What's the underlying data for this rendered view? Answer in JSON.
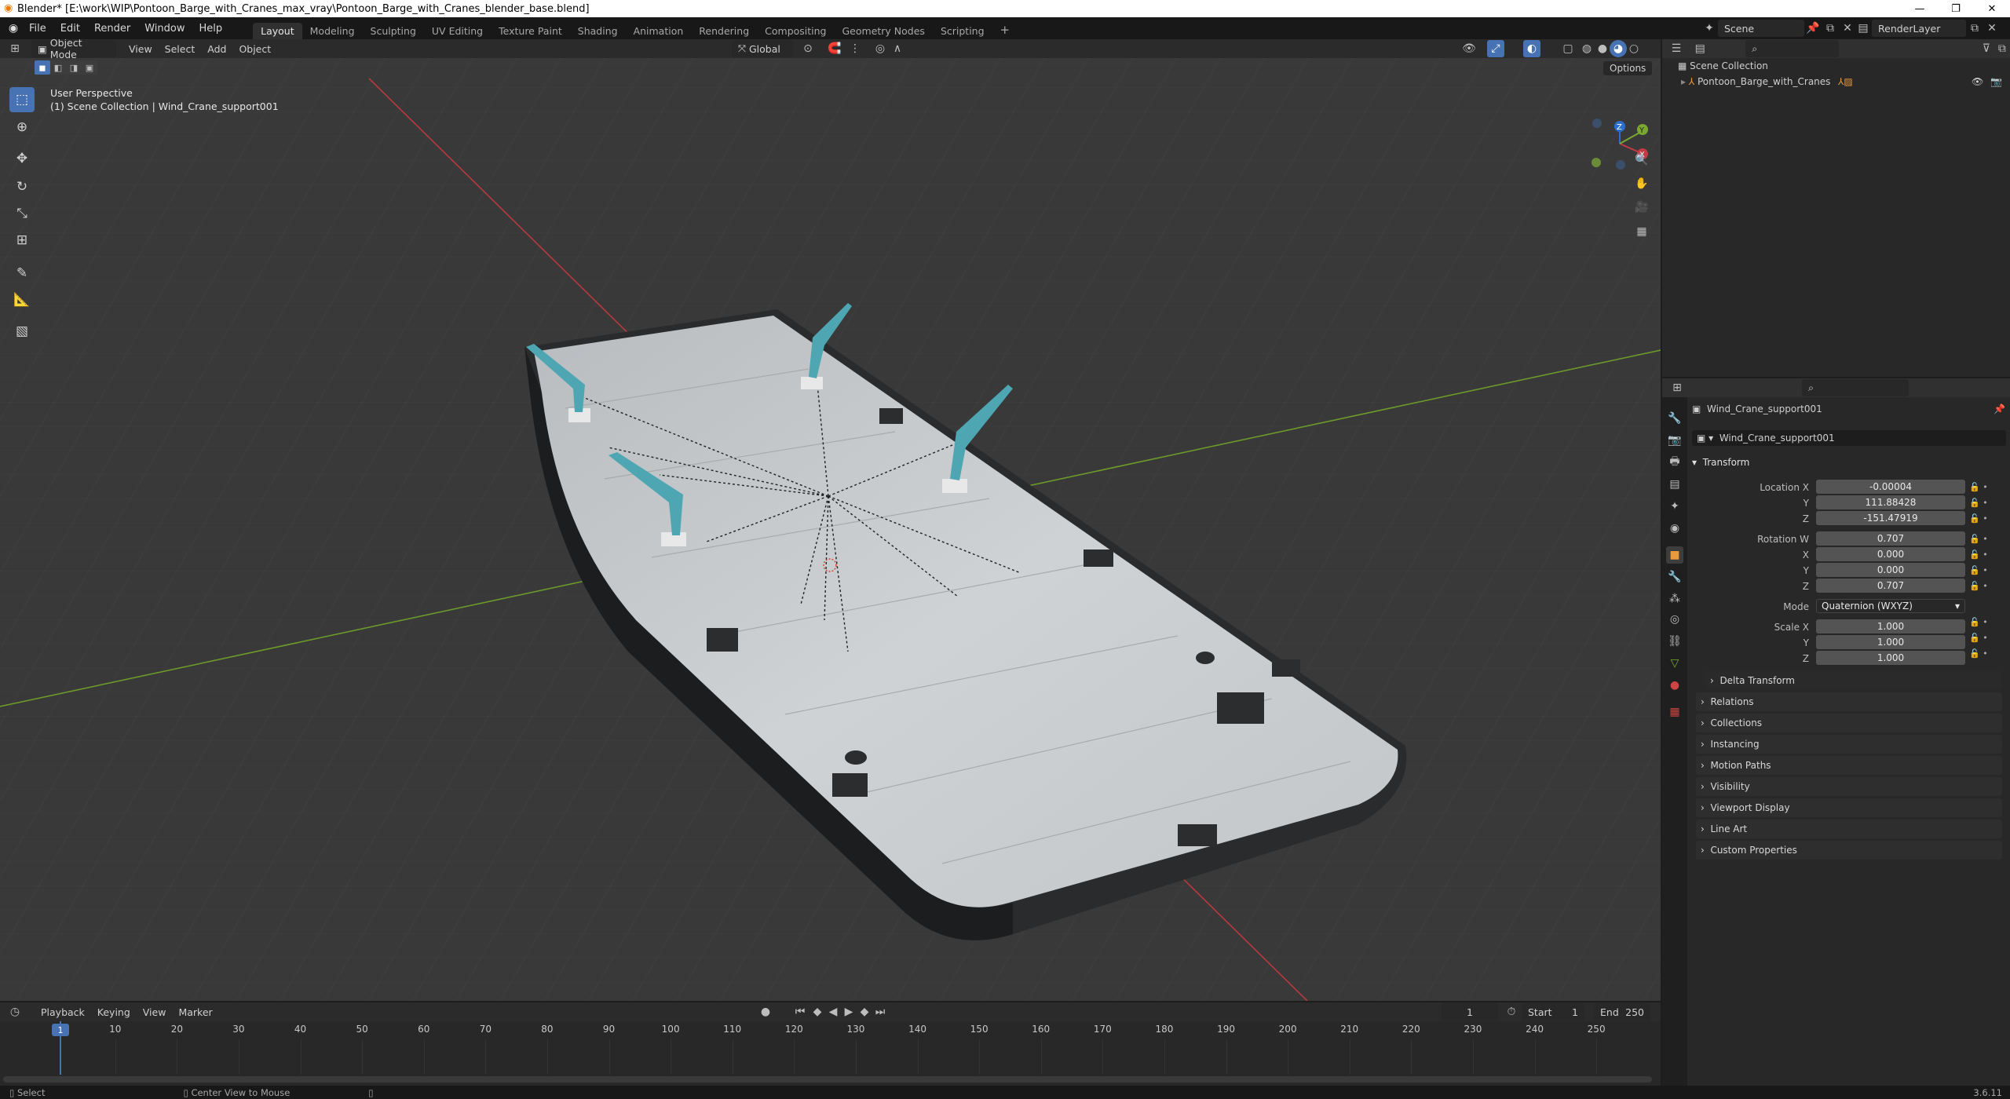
{
  "window": {
    "title": "Blender* [E:\\work\\WIP\\Pontoon_Barge_with_Cranes_max_vray\\Pontoon_Barge_with_Cranes_blender_base.blend]",
    "minimize": "—",
    "maximize": "❐",
    "close": "✕"
  },
  "menubar": {
    "items": [
      "File",
      "Edit",
      "Render",
      "Window",
      "Help"
    ],
    "workspaces": [
      "Layout",
      "Modeling",
      "Sculpting",
      "UV Editing",
      "Texture Paint",
      "Shading",
      "Animation",
      "Rendering",
      "Compositing",
      "Geometry Nodes",
      "Scripting"
    ],
    "add_tab": "+",
    "scene_label": "Scene",
    "render_layer": "RenderLayer"
  },
  "viewport": {
    "mode": "Object Mode",
    "menus": [
      "View",
      "Select",
      "Add",
      "Object"
    ],
    "transform_orientation": "Global",
    "options_label": "Options",
    "overlay_line1": "User Perspective",
    "overlay_line2": "(1) Scene Collection | Wind_Crane_support001",
    "gizmo": {
      "x": "X",
      "y": "Y",
      "z": "Z"
    }
  },
  "outliner": {
    "scene_collection": "Scene Collection",
    "items": [
      {
        "label": "Pontoon_Barge_with_Cranes"
      }
    ]
  },
  "properties": {
    "object_name": "Wind_Crane_support001",
    "data_name": "Wind_Crane_support001",
    "transform_title": "Transform",
    "location": {
      "label": "Location X",
      "x": "-0.00004",
      "y_label": "Y",
      "y": "111.88428",
      "z_label": "Z",
      "z": "-151.47919"
    },
    "rotation": {
      "label": "Rotation W",
      "w": "0.707",
      "x_label": "X",
      "x": "0.000",
      "y_label": "Y",
      "y": "0.000",
      "z_label": "Z",
      "z": "0.707"
    },
    "mode_label": "Mode",
    "mode_value": "Quaternion (WXYZ)",
    "scale": {
      "label": "Scale X",
      "x": "1.000",
      "y_label": "Y",
      "y": "1.000",
      "z_label": "Z",
      "z": "1.000"
    },
    "delta_transform": "Delta Transform",
    "panels": [
      "Relations",
      "Collections",
      "Instancing",
      "Motion Paths",
      "Visibility",
      "Viewport Display",
      "Line Art",
      "Custom Properties"
    ]
  },
  "timeline": {
    "menus": [
      "Playback",
      "Keying",
      "View",
      "Marker"
    ],
    "current_frame": "1",
    "start_label": "Start",
    "start": "1",
    "end_label": "End",
    "end": "250",
    "frame_marker": "1",
    "ticks": [
      "10",
      "20",
      "30",
      "40",
      "50",
      "60",
      "70",
      "80",
      "90",
      "100",
      "110",
      "120",
      "130",
      "140",
      "150",
      "160",
      "170",
      "180",
      "190",
      "200",
      "210",
      "220",
      "230",
      "240",
      "250"
    ]
  },
  "statusbar": {
    "select": "Select",
    "center_view": "Center View to Mouse",
    "version": "3.6.11"
  },
  "colors": {
    "accent": "#4772b3",
    "crane": "#4fa6b3",
    "deck": "#c9ccce",
    "hull": "#2a2b2c",
    "grid_bg": "#393939",
    "axis_red": "#b8393f",
    "axis_green": "#6c9a2a"
  }
}
